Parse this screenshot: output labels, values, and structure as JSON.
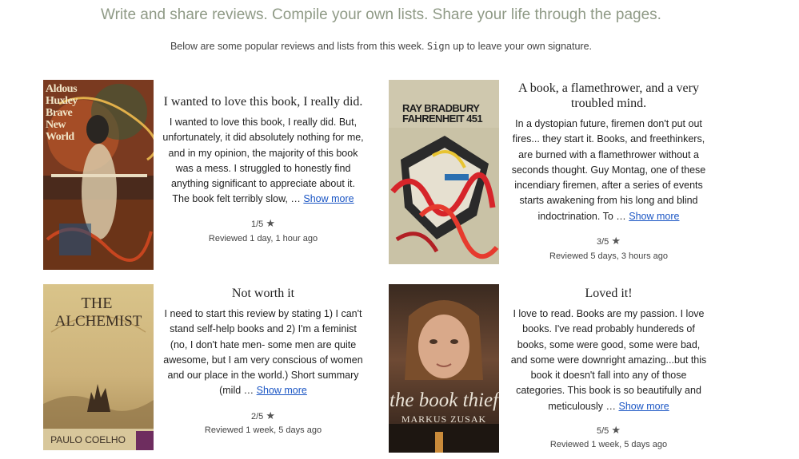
{
  "header": {
    "headline": "Write and share reviews. Compile your own lists. Share your life through the pages.",
    "sub_before": "Below are some popular reviews and lists from this week. ",
    "signup_label": "Sign",
    "sub_after": " up to leave your own signature."
  },
  "reviews": [
    {
      "cover_lines": [
        "Aldous",
        "Huxley",
        "Brave",
        "New",
        "World"
      ],
      "title": "I wanted to love this book, I really did.",
      "excerpt": "I wanted to love this book, I really did. But, unfortunately, it did absolutely nothing for me, and in my opinion, the majority of this book was a mess. I struggled to honestly find anything significant to appreciate about it. The book felt terribly slow, …",
      "more_label": "Show more",
      "rating": "1/5",
      "reviewed": "Reviewed 1 day, 1 hour ago"
    },
    {
      "cover_lines": [
        "RAY BRADBURY",
        "FAHRENHEIT 451"
      ],
      "title": "A book, a flamethrower, and a very troubled mind.",
      "excerpt": "In a dystopian future, firemen don't put out fires... they start it. Books, and freethinkers, are burned with a flamethrower without a seconds thought. Guy Montag, one of these incendiary firemen, after a series of events starts awakening from his long and blind indoctrination. To …",
      "more_label": "Show more",
      "rating": "3/5",
      "reviewed": "Reviewed 5 days, 3 hours ago"
    },
    {
      "cover_lines": [
        "THE",
        "ALCHEMIST",
        "PAULO COELHO"
      ],
      "title": "Not worth it",
      "excerpt": "I need to start this review by stating 1) I can't stand self-help books and 2) I'm a feminist (no, I don't hate men- some men are quite awesome, but I am very conscious of women and our place in the world.) Short summary (mild …",
      "more_label": "Show more",
      "rating": "2/5",
      "reviewed": "Reviewed 1 week, 5 days ago"
    },
    {
      "cover_lines": [
        "the book thief",
        "MARKUS ZUSAK"
      ],
      "title": "Loved it!",
      "excerpt": "I love to read. Books are my passion. I love books. I've read probably hundereds of books, some were good, some were bad, and some were downright amazing...but this book it doesn't fall into any of those categories. This book is so beautifully and meticulously …",
      "more_label": "Show more",
      "rating": "5/5",
      "reviewed": "Reviewed 1 week, 5 days ago"
    }
  ],
  "colors": {
    "headline": "#8f9a86",
    "link": "#1a55c4",
    "star": "#555555"
  },
  "icons": {
    "rating": "star-icon"
  }
}
